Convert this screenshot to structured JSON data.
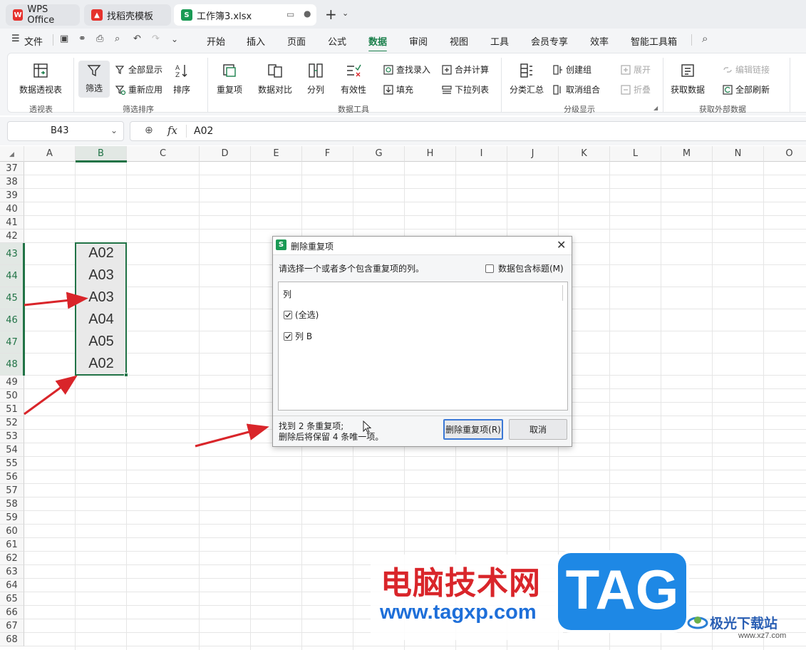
{
  "tabs": [
    {
      "label": "WPS Office",
      "icon": "wps-logo-icon"
    },
    {
      "label": "找稻壳模板",
      "icon": "docer-icon"
    },
    {
      "label": "工作簿3.xlsx",
      "icon": "sheet-s-icon"
    }
  ],
  "menu": {
    "file": "文件",
    "items": [
      "开始",
      "插入",
      "页面",
      "公式",
      "数据",
      "审阅",
      "视图",
      "工具",
      "会员专享",
      "效率",
      "智能工具箱"
    ],
    "active": "数据"
  },
  "ribbon": {
    "pivot": "数据透视表",
    "filter": "筛选",
    "show_all": "全部显示",
    "reapply": "重新应用",
    "sort": "排序",
    "duplicates": "重复项",
    "compare": "数据对比",
    "split": "分列",
    "validity": "有效性",
    "lookup_entry": "查找录入",
    "fill": "填充",
    "consolidate": "合并计算",
    "dropdown": "下拉列表",
    "subtotal": "分类汇总",
    "create_group": "创建组",
    "ungroup": "取消组合",
    "expand": "展开",
    "collapse": "折叠",
    "get_data": "获取数据",
    "edit_links": "编辑链接",
    "refresh_all": "全部刷新",
    "groups": {
      "pivot": "透视表",
      "filter_sort": "筛选排序",
      "data_tools": "数据工具",
      "outline": "分级显示",
      "external": "获取外部数据"
    }
  },
  "formula_bar": {
    "name_box": "B43",
    "fx": "fx",
    "value": "A02"
  },
  "columns": [
    "A",
    "B",
    "C",
    "D",
    "E",
    "F",
    "G",
    "H",
    "I",
    "J",
    "K",
    "L",
    "M",
    "N",
    "O"
  ],
  "rows": [
    "37",
    "38",
    "39",
    "40",
    "41",
    "42",
    "43",
    "44",
    "45",
    "46",
    "47",
    "48",
    "49",
    "50",
    "51",
    "52",
    "53",
    "54",
    "55",
    "56",
    "57",
    "58",
    "59",
    "60",
    "61",
    "62",
    "63",
    "64",
    "65",
    "66",
    "67",
    "68"
  ],
  "cells": [
    "A02",
    "A03",
    "A03",
    "A04",
    "A05",
    "A02"
  ],
  "dialog": {
    "title": "删除重复项",
    "instruction": "请选择一个或者多个包含重复项的列。",
    "header_checkbox": "数据包含标题(M)",
    "list_header": "列",
    "options": [
      "(全选)",
      "列 B"
    ],
    "result_line1": "找到 2 条重复项;",
    "result_line2": "删除后将保留 4 条唯一项。",
    "confirm": "删除重复项(R)",
    "cancel": "取消"
  },
  "watermark": {
    "site_name": "电脑技术网",
    "url": "www.tagxp.com",
    "logo": "TAG",
    "corner": "极光下载站",
    "corner_url": "www.xz7.com"
  },
  "colors": {
    "accent": "#1a7f4b",
    "selection": "#217346",
    "arrow": "#d9252a",
    "logo_blue": "#1e88e5"
  }
}
